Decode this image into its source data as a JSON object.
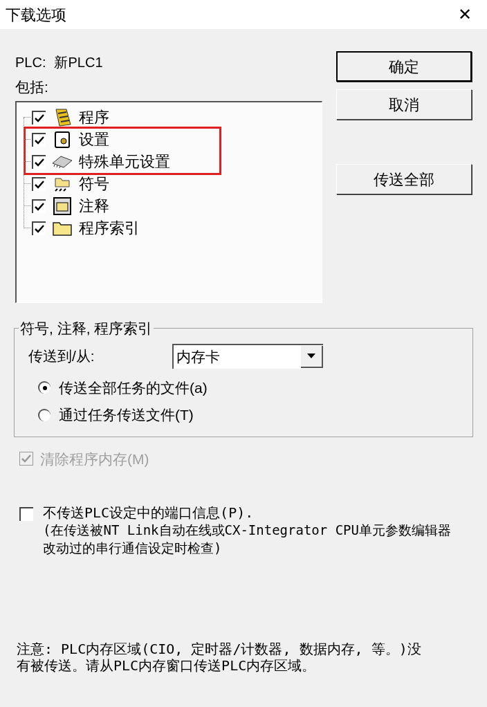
{
  "window": {
    "title": "下载选项",
    "close": "✕"
  },
  "plc": {
    "label": "PLC:",
    "value": "新PLC1"
  },
  "include_label": "包括:",
  "tree": [
    {
      "label": "程序",
      "kind": "program",
      "checked": true,
      "highlighted": false
    },
    {
      "label": "设置",
      "kind": "settings",
      "checked": true,
      "highlighted": true
    },
    {
      "label": "特殊单元设置",
      "kind": "chip",
      "checked": true,
      "highlighted": true
    },
    {
      "label": "符号",
      "kind": "symbol",
      "checked": true,
      "highlighted": false
    },
    {
      "label": "注释",
      "kind": "comment",
      "checked": true,
      "highlighted": false
    },
    {
      "label": "程序索引",
      "kind": "folder",
      "checked": true,
      "highlighted": false
    }
  ],
  "buttons": [
    {
      "label": "确定",
      "default": true
    },
    {
      "label": "取消",
      "default": false
    },
    {
      "label": "传送全部",
      "default": false
    }
  ],
  "group": {
    "title": "符号, 注释, 程序索引",
    "transfer_label": "传送到/从:",
    "transfer_value": "内存卡",
    "radios": [
      {
        "label": "传送全部任务的文件(a)",
        "selected": true
      },
      {
        "label": "通过任务传送文件(T)",
        "selected": false
      }
    ]
  },
  "clear_memory": {
    "label": "清除程序内存(M)",
    "checked": true,
    "disabled": true
  },
  "port_info": {
    "label": "不传送PLC设定中的端口信息(P).",
    "note": "(在传送被NT Link自动在线或CX-Integrator CPU单元参数编辑器改动过的串行通信设定时检查)",
    "checked": false,
    "disabled": false
  },
  "footer_note": "注意: PLC内存区域(CIO, 定时器/计数器, 数据内存, 等。)没有被传送。请从PLC内存窗口传送PLC内存区域。"
}
